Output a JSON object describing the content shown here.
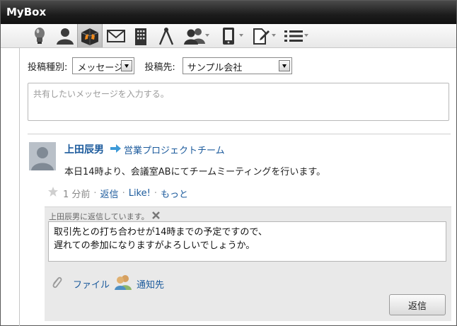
{
  "window": {
    "title": "MyBox"
  },
  "toolbar": {
    "items": [
      {
        "icon": "lightbulb-icon"
      },
      {
        "icon": "user-icon"
      },
      {
        "icon": "box-icon",
        "active": true
      },
      {
        "icon": "mail-icon"
      },
      {
        "icon": "building-icon"
      },
      {
        "icon": "compass-icon"
      },
      {
        "icon": "group-icon",
        "dropdown": true
      },
      {
        "icon": "phone-icon",
        "dropdown": true
      },
      {
        "icon": "document-edit-icon",
        "dropdown": true
      },
      {
        "icon": "list-icon",
        "dropdown": true
      }
    ]
  },
  "compose": {
    "type_label": "投稿種別:",
    "type_value": "メッセージ",
    "target_label": "投稿先:",
    "target_value": "サンプル会社",
    "placeholder": "共有したいメッセージを入力する。"
  },
  "post": {
    "author": "上田辰男",
    "group": "営業プロジェクトチーム",
    "body": "本日14時より、会議室ABにてチームミーティングを行います。",
    "time": "1 分前",
    "actions": {
      "reply": "返信",
      "like": "Like!",
      "more": "もっと"
    }
  },
  "reply": {
    "replying_to": "上田辰男に返信しています。",
    "line1": "取引先との打ち合わせが14時までの予定ですので、",
    "line2": "遅れての参加になりますがよろしいでしょうか。",
    "file_label": "ファイル",
    "notify_label": "通知先",
    "submit_label": "返信"
  },
  "colors": {
    "link": "#1b5a9c",
    "titlebar": "#1c1c1c"
  }
}
